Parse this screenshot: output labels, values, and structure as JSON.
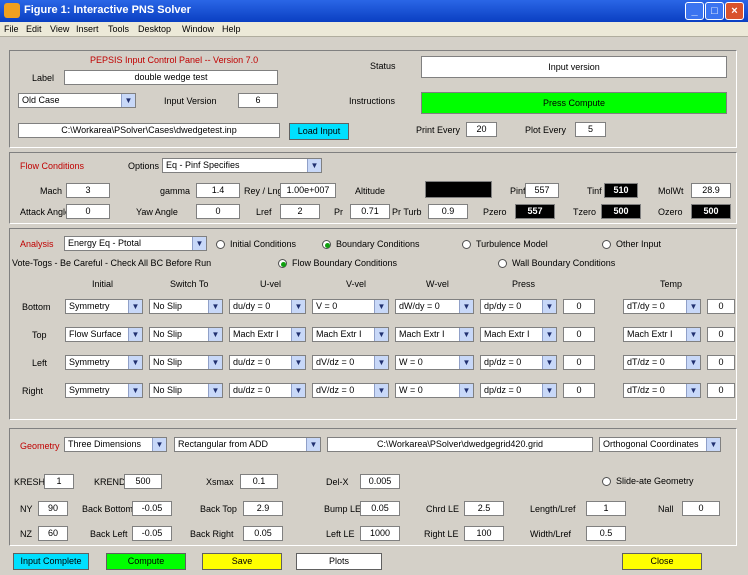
{
  "window": {
    "title": "Figure 1: Interactive PNS Solver"
  },
  "menu": [
    "File",
    "Edit",
    "View",
    "Insert",
    "Tools",
    "Desktop",
    "Window",
    "Help"
  ],
  "colors": {
    "red_text": "#c00000",
    "compute_green": "#00ff00",
    "input_complete_cyan": "#00e0ff",
    "close_yellow": "#ffff00",
    "black_box": "#000000"
  },
  "top": {
    "title": "PEPSIS Input Control Panel -- Version 7.0",
    "label_label": "Label",
    "label_value": "double wedge test",
    "case_select": "Old Case",
    "input_version_label": "Input Version",
    "input_version_value": "6",
    "path_value": "C:\\Workarea\\PSolver\\Cases\\dwedgetest.inp",
    "load_input": "Load Input",
    "status_label": "Status",
    "status_value": "Input version",
    "instructions_label": "Instructions",
    "instructions_value": "Press Compute",
    "print_every_label": "Print Every",
    "print_every_value": "20",
    "plot_every_label": "Plot Every",
    "plot_every_value": "5"
  },
  "flow": {
    "title": "Flow Conditions",
    "options_label": "Options",
    "options_value": "Eq - Pinf Specifies",
    "mach_label": "Mach",
    "mach_value": "3",
    "gamma_label": "gamma",
    "gamma_value": "1.4",
    "reynolds_label": "Rey / Lng",
    "reynolds_value": "1.00e+007",
    "altitude_label": "Altitude",
    "pinf_label": "Pinf",
    "pinf_value": "557",
    "tinf_label": "Tinf",
    "tinf_value": "510",
    "molwt_label": "MolWt",
    "molwt_value": "28.9",
    "attack_label": "Attack Angle",
    "attack_value": "0",
    "yaw_label": "Yaw Angle",
    "yaw_value": "0",
    "lref_label": "Lref",
    "lref_value": "2",
    "pr_label": "Pr",
    "pr_value": "0.71",
    "prturb_label": "Pr Turb",
    "prturb_value": "0.9",
    "pzero_label": "Pzero",
    "pzero_value": "557",
    "tzero_label": "Tzero",
    "tzero_value": "500",
    "ozero_label": "Ozero",
    "ozero_value": "500"
  },
  "analysis": {
    "title": "Analysis",
    "select_value": "Energy Eq - Ptotal",
    "radios": [
      {
        "label": "Initial Conditions",
        "on": false
      },
      {
        "label": "Boundary Conditions",
        "on": true
      },
      {
        "label": "Turbulence Model",
        "on": false
      },
      {
        "label": "Other Input",
        "on": false
      }
    ],
    "note": "Vote-Togs - Be Careful - Check All BC Before Run",
    "flow_bc": {
      "label": "Flow Boundary Conditions",
      "on": true
    },
    "wall_bc": {
      "label": "Wall Boundary Conditions",
      "on": false
    },
    "col_headers": [
      "Initial",
      "Switch To",
      "U-vel",
      "V-vel",
      "W-vel",
      "Press",
      "Temp"
    ],
    "rows": [
      {
        "name": "Bottom",
        "cells": [
          "Symmetry",
          "No Slip",
          "du/dy = 0",
          "V = 0",
          "dW/dy = 0",
          "dp/dy = 0",
          "0",
          "dT/dy = 0",
          "0"
        ]
      },
      {
        "name": "Top",
        "cells": [
          "Flow Surface",
          "No Slip",
          "Mach Extr I",
          "Mach Extr I",
          "Mach Extr I",
          "Mach Extr I",
          "0",
          "Mach Extr I",
          "0"
        ]
      },
      {
        "name": "Left",
        "cells": [
          "Symmetry",
          "No Slip",
          "du/dz = 0",
          "dV/dz = 0",
          "W = 0",
          "dp/dz = 0",
          "0",
          "dT/dz = 0",
          "0"
        ]
      },
      {
        "name": "Right",
        "cells": [
          "Symmetry",
          "No Slip",
          "du/dz = 0",
          "dV/dz = 0",
          "W = 0",
          "dp/dz = 0",
          "0",
          "dT/dz = 0",
          "0"
        ]
      }
    ]
  },
  "geometry": {
    "title": "Geometry",
    "dims_value": "Three Dimensions",
    "shape_value": "Rectangular from ADD",
    "grid_path": "C:\\Workarea\\PSolver\\dwedgegrid420.grid",
    "coords_value": "Orthogonal Coordinates",
    "istep_label": "KRESH",
    "istep_value": "1",
    "kend_label": "KREND",
    "kend_value": "500",
    "xmax_label": "Xsmax",
    "xmax_value": "0.1",
    "delx_label": "Del-X",
    "delx_value": "0.005",
    "slide_label": "Slide-ate Geometry",
    "ny_label": "NY",
    "ny_value": "90",
    "back_bottom_label": "Back Bottom",
    "back_bottom_value": "-0.05",
    "back_top_label": "Back Top",
    "back_top_value": "2.9",
    "bump_le_label": "Bump LE",
    "bump_le_value": "0.05",
    "chord_label": "Chrd LE",
    "chord_value": "2.5",
    "length_label": "Length/Lref",
    "length_value": "1",
    "nall_label": "Nall",
    "nall_value": "0",
    "nz_label": "NZ",
    "nz_value": "60",
    "back_left_label": "Back Left",
    "back_left_value": "-0.05",
    "back_right_label": "Back Right",
    "back_right_value": "0.05",
    "left_le_label": "Left LE",
    "left_le_value": "1000",
    "right_le_label": "Right LE",
    "right_le_value": "100",
    "width_label": "Width/Lref",
    "width_value": "0.5"
  },
  "bottom": {
    "input_complete": "Input Complete",
    "compute": "Compute",
    "save": "Save",
    "plots": "Plots",
    "close": "Close"
  }
}
